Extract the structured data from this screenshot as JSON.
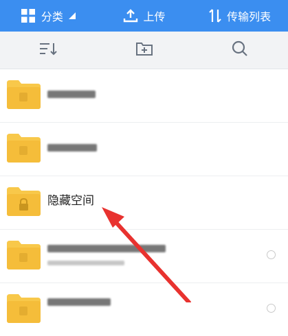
{
  "topbar": {
    "category": {
      "label": "分类",
      "icon": "grid-icon"
    },
    "upload": {
      "label": "上传",
      "icon": "upload-icon"
    },
    "transfer": {
      "label": "传输列表",
      "icon": "transfer-arrows-icon"
    }
  },
  "toolbar": {
    "sort_icon": "sort-icon",
    "new_folder_icon": "new-folder-icon",
    "search_icon": "search-icon"
  },
  "files": [
    {
      "name": "",
      "blurred": true
    },
    {
      "name": "",
      "blurred": true
    },
    {
      "name": "隐藏空间",
      "blurred": false,
      "locked": true
    },
    {
      "name": "",
      "blurred": true
    },
    {
      "name": "",
      "blurred": true
    }
  ],
  "colors": {
    "accent": "#3b8ef0",
    "folder": "#f8c84a",
    "arrow": "#e8322f"
  }
}
